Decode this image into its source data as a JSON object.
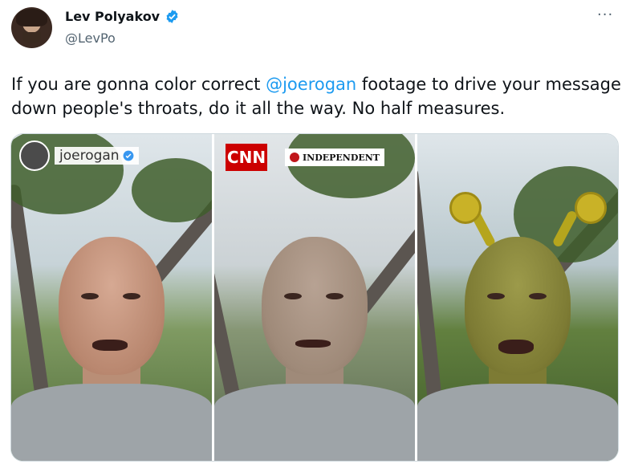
{
  "author": {
    "name": "Lev Polyakov",
    "handle": "@LevPo",
    "verified_icon": "verified-badge-icon"
  },
  "menu": {
    "more_label": "···"
  },
  "tweet": {
    "text_before": "If you are gonna color correct ",
    "mention": "@joerogan",
    "text_after": " footage to drive your message down people's throats, do it all the way. No half measures."
  },
  "media": {
    "panel1": {
      "overlay_name": "joerogan"
    },
    "panel2": {
      "cnn_label": "CNN",
      "independent_label": "INDEPENDENT"
    }
  },
  "colors": {
    "link": "#1d9bf0",
    "verified": "#1d9bf0",
    "secondary_text": "#536471"
  }
}
